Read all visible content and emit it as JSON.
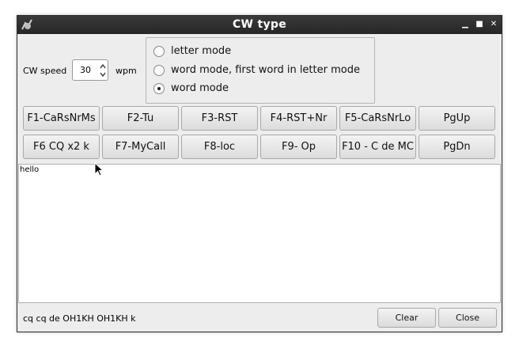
{
  "window": {
    "title": "CW type"
  },
  "speed": {
    "label": "CW speed",
    "value": "30",
    "unit": "wpm"
  },
  "modes": [
    {
      "label": "letter mode",
      "checked": false
    },
    {
      "label": "word mode, first word in letter mode",
      "checked": false
    },
    {
      "label": "word mode",
      "checked": true
    }
  ],
  "fkeys_row1": [
    "F1-CaRsNrMs",
    "F2-Tu",
    "F3-RST",
    "F4-RST+Nr",
    "F5-CaRsNrLo",
    "PgUp"
  ],
  "fkeys_row2": [
    "F6 CQ x2 k",
    "F7-MyCall",
    "F8-loc",
    "F9- Op",
    "F10 - C de MC",
    "PgDn"
  ],
  "text_area": {
    "content": "hello"
  },
  "status": {
    "text": "cq cq de OH1KH OH1KH k"
  },
  "buttons": {
    "clear": "Clear",
    "close": "Close"
  }
}
